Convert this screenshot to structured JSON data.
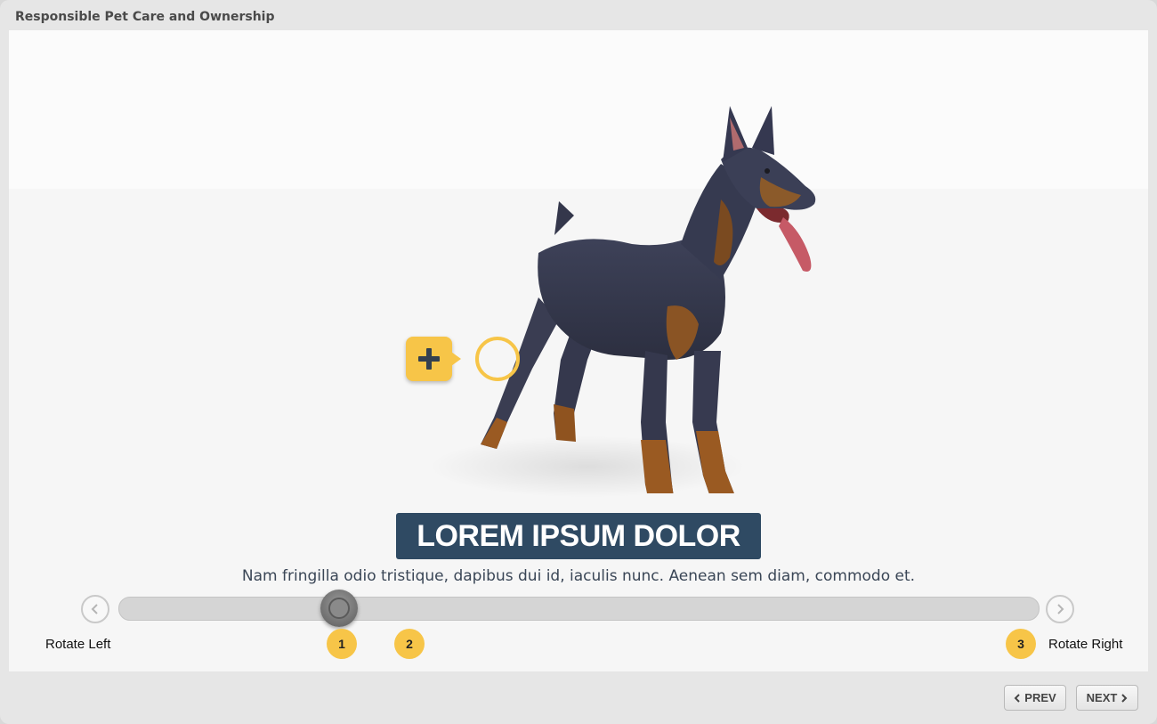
{
  "window": {
    "title": "Responsible Pet Care and Ownership"
  },
  "content": {
    "heading": "LOREM IPSUM DOLOR",
    "description": "Nam fringilla odio tristique, dapibus dui id, iaculis nunc. Aenean sem diam, commodo et."
  },
  "rotation": {
    "left_label": "Rotate Left",
    "right_label": "Rotate Right",
    "markers": [
      "1",
      "2",
      "3"
    ],
    "position_fraction": 0.24
  },
  "nav": {
    "prev_label": "PREV",
    "next_label": "NEXT"
  },
  "colors": {
    "accent": "#f7c548",
    "heading_bg": "#2f4a63",
    "text": "#3a4656"
  },
  "icons": {
    "hotspot": "plus-icon",
    "rotate_left": "chevron-left-icon",
    "rotate_right": "chevron-right-icon",
    "prev": "caret-left-icon",
    "next": "caret-right-icon"
  }
}
